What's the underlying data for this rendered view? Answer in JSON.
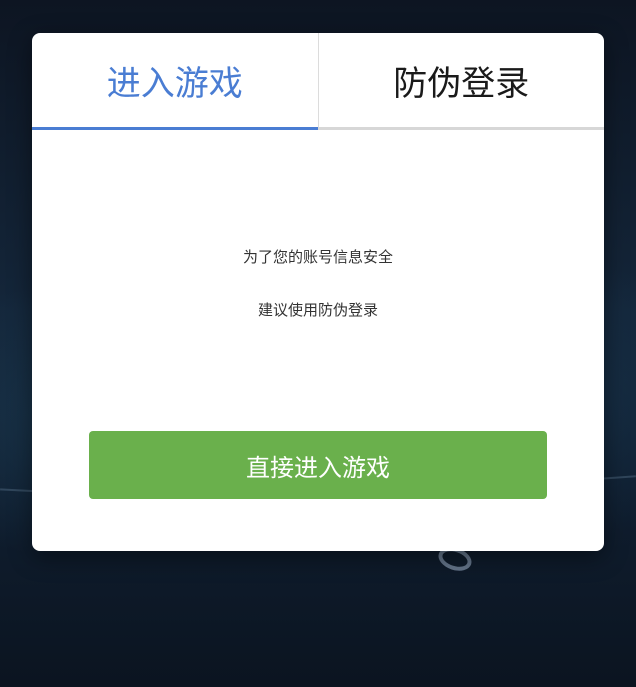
{
  "tabs": [
    {
      "label": "进入游戏",
      "active": true
    },
    {
      "label": "防伪登录",
      "active": false
    }
  ],
  "message": {
    "line1": "为了您的账号信息安全",
    "line2": "建议使用防伪登录"
  },
  "button": {
    "label": "直接进入游戏"
  },
  "colors": {
    "accent": "#4a7dd3",
    "button": "#6ab04c",
    "background": "#0f1d2e"
  }
}
